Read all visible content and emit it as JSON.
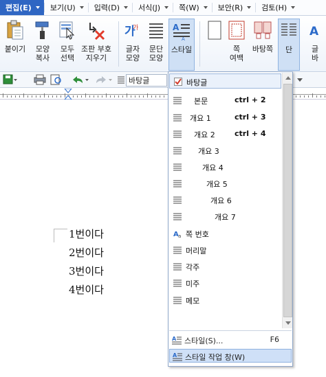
{
  "menubar": {
    "items": [
      {
        "label": "편집(E)",
        "active": true
      },
      {
        "label": "보기(U)"
      },
      {
        "label": "입력(D)"
      },
      {
        "label": "서식(J)"
      },
      {
        "label": "쪽(W)"
      },
      {
        "label": "보안(R)"
      },
      {
        "label": "검토(H)"
      }
    ]
  },
  "ribbon": {
    "buttons": [
      {
        "label": "붙이기",
        "icon": "paste-icon"
      },
      {
        "label": "모양\n복사",
        "icon": "format-painter-icon"
      },
      {
        "label": "모두\n선택",
        "icon": "select-all-icon"
      },
      {
        "label": "조판 부호\n지우기",
        "icon": "clear-marks-icon"
      },
      {
        "label": "글자\n모양",
        "icon": "char-shape-icon"
      },
      {
        "label": "문단\n모양",
        "icon": "para-shape-icon"
      },
      {
        "label": "스타일",
        "icon": "style-icon"
      },
      {
        "label": "",
        "icon": "page-icon"
      },
      {
        "label": "쪽\n여백",
        "icon": "page-margin-icon"
      },
      {
        "label": "바탕쪽",
        "icon": "master-page-icon"
      },
      {
        "label": "단",
        "icon": "columns-icon"
      },
      {
        "label": "글\n바",
        "icon": "text-direction-icon"
      }
    ]
  },
  "toolbar": {
    "style_value": "바탕글"
  },
  "document": {
    "paragraphs": [
      "1번이다",
      "2번이다",
      "3번이다",
      "4번이다"
    ]
  },
  "style_menu": {
    "items": [
      {
        "label": "바탕글",
        "shortcut": "",
        "selected": true
      },
      {
        "label": "본문",
        "shortcut": "ctrl + 2"
      },
      {
        "label": "개요 1",
        "shortcut": "ctrl + 3"
      },
      {
        "label": "개요 2",
        "shortcut": "ctrl + 4"
      },
      {
        "label": "개요 3",
        "shortcut": ""
      },
      {
        "label": "개요 4",
        "shortcut": ""
      },
      {
        "label": "개요 5",
        "shortcut": ""
      },
      {
        "label": "개요 6",
        "shortcut": ""
      },
      {
        "label": "개요 7",
        "shortcut": ""
      },
      {
        "label": "쪽 번호",
        "shortcut": ""
      },
      {
        "label": "머리말",
        "shortcut": ""
      },
      {
        "label": "각주",
        "shortcut": ""
      },
      {
        "label": "미주",
        "shortcut": ""
      },
      {
        "label": "메모",
        "shortcut": ""
      }
    ],
    "style_dialog": {
      "label": "스타일(S)...",
      "shortcut": "F6"
    },
    "style_pane": {
      "label": "스타일 작업 창(W)"
    }
  },
  "colors": {
    "accent": "#2f66c3",
    "selection": "#cfe0f7"
  }
}
